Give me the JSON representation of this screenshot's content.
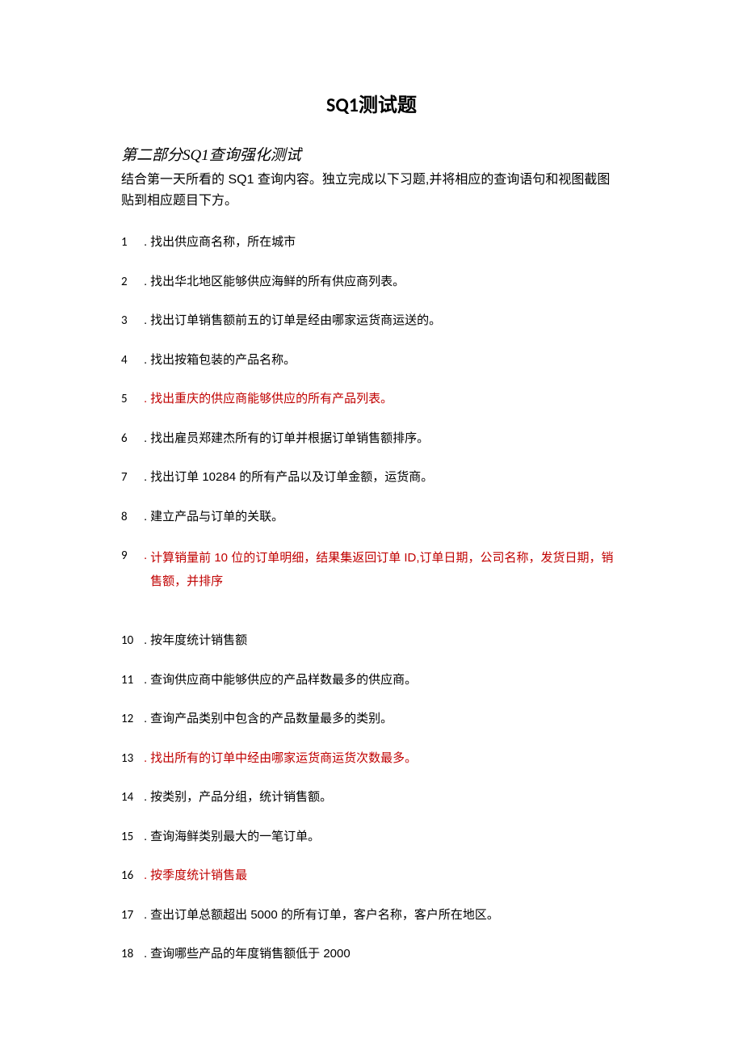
{
  "title": "SQ1测试题",
  "subtitle": "第二部分SQ1查询强化测试",
  "intro": "结合第一天所看的 SQ1 查询内容。独立完成以下习题,并将相应的查询语句和视图截图贴到相应题目下方。",
  "items": [
    {
      "num": "1",
      "text": "找出供应商名称，所在城市",
      "highlight": false
    },
    {
      "num": "2",
      "text": "找出华北地区能够供应海鲜的所有供应商列表。",
      "highlight": false
    },
    {
      "num": "3",
      "text": "找出订单销售额前五的订单是经由哪家运货商运送的。",
      "highlight": false
    },
    {
      "num": "4",
      "text": "找出按箱包装的产品名称。",
      "highlight": false
    },
    {
      "num": "5",
      "text": "找出重庆的供应商能够供应的所有产品列表。",
      "highlight": true
    },
    {
      "num": "6",
      "text": "找出雇员郑建杰所有的订单并根据订单销售额排序。",
      "highlight": false
    },
    {
      "num": "7",
      "text": "找出订单 10284 的所有产品以及订单金额，运货商。",
      "highlight": false
    },
    {
      "num": "8",
      "text": "建立产品与订单的关联。",
      "highlight": false
    },
    {
      "num": "9",
      "text": "计算销量前 10 位的订单明细，结果集返回订单 ID,订单日期，公司名称，发货日期，销售额，并排序",
      "highlight": true
    },
    {
      "num": "10",
      "text": "按年度统计销售额",
      "highlight": false
    },
    {
      "num": "11",
      "text": "查询供应商中能够供应的产品样数最多的供应商。",
      "highlight": false
    },
    {
      "num": "12",
      "text": "查询产品类别中包含的产品数量最多的类别。",
      "highlight": false
    },
    {
      "num": "13",
      "text": "找出所有的订单中经由哪家运货商运货次数最多。",
      "highlight": true
    },
    {
      "num": "14",
      "text": "按类别，产品分组，统计销售额。",
      "highlight": false
    },
    {
      "num": "15",
      "text": "查询海鲜类别最大的一笔订单。",
      "highlight": false
    },
    {
      "num": "16",
      "text": "按季度统计销售最",
      "highlight": true
    },
    {
      "num": "17",
      "text": "查出订单总额超出 5000 的所有订单，客户名称，客户所在地区。",
      "highlight": false
    },
    {
      "num": "18",
      "text": "查询哪些产品的年度销售额低于 2000",
      "highlight": false
    }
  ]
}
